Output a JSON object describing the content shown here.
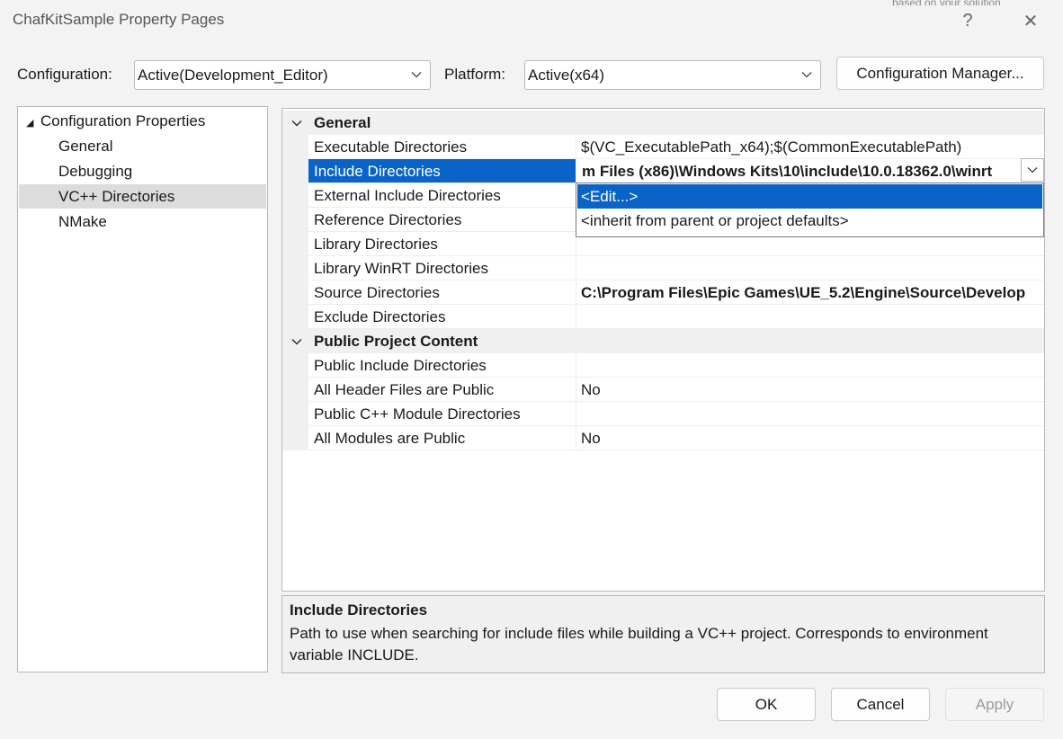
{
  "window": {
    "title": "ChafKitSample Property Pages",
    "help_glyph": "?",
    "close_glyph": "✕",
    "background_snippet": "based on your solution"
  },
  "config_bar": {
    "configuration_label": "Configuration:",
    "configuration_value": "Active(Development_Editor)",
    "platform_label": "Platform:",
    "platform_value": "Active(x64)",
    "config_manager_button": "Configuration Manager..."
  },
  "tree": {
    "root_label": "Configuration Properties",
    "expander_glyph": "◢",
    "items": [
      {
        "label": "General"
      },
      {
        "label": "Debugging"
      },
      {
        "label": "VC++ Directories",
        "selected": true
      },
      {
        "label": "NMake"
      }
    ]
  },
  "grid": {
    "categories": [
      {
        "label": "General",
        "properties": [
          {
            "name": "Executable Directories",
            "value": "$(VC_ExecutablePath_x64);$(CommonExecutablePath)",
            "bold": false
          },
          {
            "name": "Include Directories",
            "value": "m Files (x86)\\Windows Kits\\10\\include\\10.0.18362.0\\winrt",
            "bold": true,
            "selected": true
          },
          {
            "name": "External Include Directories",
            "value": "",
            "bold": false
          },
          {
            "name": "Reference Directories",
            "value": "",
            "bold": false
          },
          {
            "name": "Library Directories",
            "value": "",
            "bold": false
          },
          {
            "name": "Library WinRT Directories",
            "value": "",
            "bold": false
          },
          {
            "name": "Source Directories",
            "value": "C:\\Program Files\\Epic Games\\UE_5.2\\Engine\\Source\\Develop",
            "bold": true
          },
          {
            "name": "Exclude Directories",
            "value": "",
            "bold": false
          }
        ]
      },
      {
        "label": "Public Project Content",
        "properties": [
          {
            "name": "Public Include Directories",
            "value": "",
            "bold": false
          },
          {
            "name": "All Header Files are Public",
            "value": "No",
            "bold": false
          },
          {
            "name": "Public C++ Module Directories",
            "value": "",
            "bold": false
          },
          {
            "name": "All Modules are Public",
            "value": "No",
            "bold": false
          }
        ]
      }
    ],
    "dropdown_options": [
      "<Edit...>",
      "<inherit from parent or project defaults>"
    ],
    "dropdown_highlighted": "<Edit...>"
  },
  "description": {
    "title": "Include Directories",
    "text": "Path to use when searching for include files while building a VC++ project.  Corresponds to environment variable INCLUDE."
  },
  "buttons": {
    "ok": "OK",
    "cancel": "Cancel",
    "apply": "Apply",
    "apply_enabled": false
  },
  "colors": {
    "selection": "#0a64c8",
    "dialog_bg": "#f3f3f3",
    "tree_selection": "#dcdcdc"
  }
}
